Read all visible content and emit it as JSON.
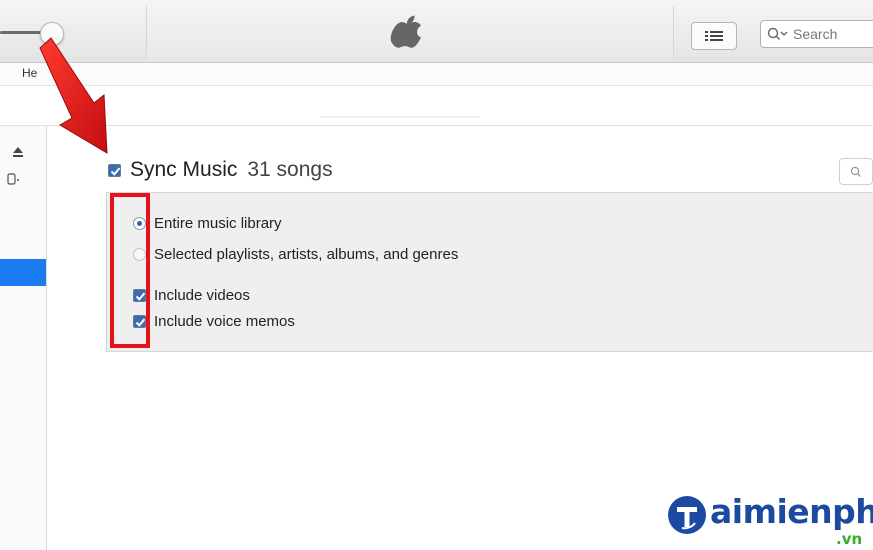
{
  "toolbar": {
    "search_placeholder": "Search",
    "icons": [
      "volume-slider",
      "apple-logo",
      "list-view-icon",
      "search-icon"
    ]
  },
  "menubar": {
    "help_label": "He"
  },
  "sync_music": {
    "checked": true,
    "title": "Sync Music",
    "count": "31 songs"
  },
  "options": [
    {
      "type": "radio",
      "label": "Entire music library",
      "checked": true
    },
    {
      "type": "radio",
      "label": "Selected playlists, artists, albums, and genres",
      "checked": false
    },
    {
      "type": "checkbox",
      "label": "Include videos",
      "checked": true
    },
    {
      "type": "checkbox",
      "label": "Include voice memos",
      "checked": true
    }
  ],
  "annotation": {
    "arrow_color": "#e3131b",
    "box_color": "#e3131b"
  },
  "watermark": {
    "logo_letter": "T",
    "text": "aimienphi",
    "suffix": ".vn"
  },
  "colors": {
    "accent": "#1b7bf0",
    "checkbox_fill": "#3b6cb0",
    "panel_bg": "#efefef"
  }
}
